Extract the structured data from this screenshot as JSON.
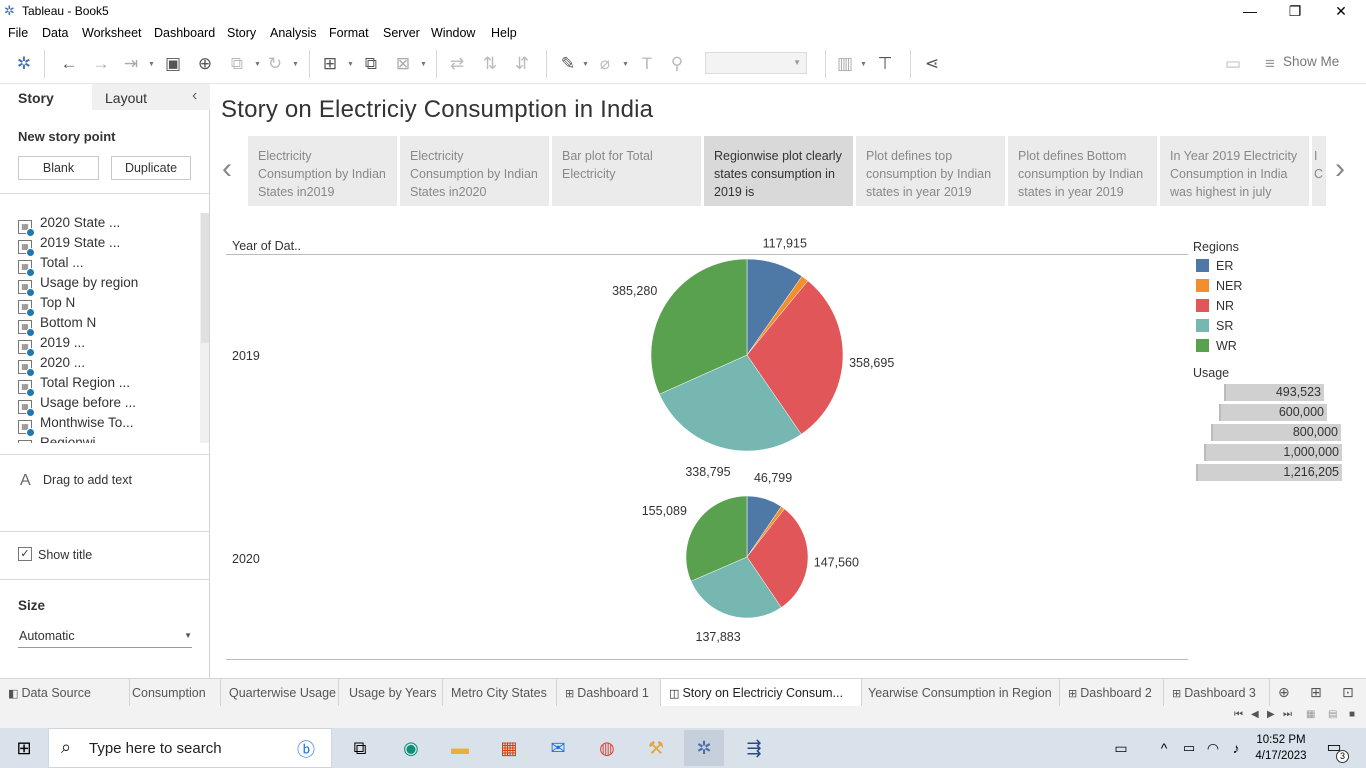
{
  "window": {
    "title": "Tableau - Book5",
    "minimize": "—",
    "maximize": "❐",
    "close": "✕"
  },
  "menu": [
    "File",
    "Data",
    "Worksheet",
    "Dashboard",
    "Story",
    "Analysis",
    "Format",
    "Server",
    "Window",
    "Help"
  ],
  "toolbar": {
    "show_me": "Show Me"
  },
  "left_pane": {
    "tabs": {
      "story": "Story",
      "layout": "Layout"
    },
    "new_story_point": "New story point",
    "blank_button": "Blank",
    "duplicate_button": "Duplicate",
    "sheets": [
      "2020 State ...",
      "2019 State ...",
      "Total ...",
      "Usage by region",
      "Top N",
      "Bottom N",
      "2019 ...",
      "2020 ...",
      "Total Region ...",
      "Usage before ...",
      "Monthwise To...",
      "Regionwi..."
    ],
    "drag_text": "Drag to add text",
    "show_title": "Show title",
    "size_label": "Size",
    "size_value": "Automatic"
  },
  "story": {
    "title": "Story on Electriciy Consumption in India",
    "points": [
      "Electricity Consumption by Indian States in2019",
      "Electricity Consumption by Indian States in2020",
      "Bar plot for Total Electricity",
      "Regionwise plot clearly states consumption in 2019 is",
      "Plot defines top consumption by Indian states in year  2019",
      "Plot defines Bottom consumption by Indian states in year  2019",
      "In Year 2019 Electricity Consumption in India was highest in july",
      "I C"
    ],
    "active_point": 3
  },
  "chart_data": {
    "type": "pie",
    "row_header": "Year of Dat..",
    "categories": [
      "ER",
      "NER",
      "NR",
      "SR",
      "WR"
    ],
    "colors": [
      "#4e79a7",
      "#f28e2b",
      "#e15759",
      "#76b7b2",
      "#59a14f"
    ],
    "series": [
      {
        "name": "2019",
        "values": [
          117915,
          15000,
          358695,
          338795,
          385280
        ],
        "labels": [
          "117,915",
          "",
          "358,695",
          "338,795",
          "385,280"
        ]
      },
      {
        "name": "2020",
        "values": [
          46799,
          5000,
          147560,
          137883,
          155089
        ],
        "labels": [
          "46,799",
          "",
          "147,560",
          "137,883",
          "155,089"
        ]
      }
    ],
    "size_legend": {
      "title": "Usage",
      "values": [
        "493,523",
        "600,000",
        "800,000",
        "1,000,000",
        "1,216,205"
      ]
    },
    "color_legend_title": "Regions"
  },
  "sheet_tabs": [
    "Data Source",
    "Consumption",
    "Quarterwise Usage",
    "Usage by Years",
    "Metro City States",
    "Dashboard 1",
    "Story on Electriciy Consum...",
    "Yearwise Consumption in Region",
    "Dashboard 2",
    "Dashboard 3"
  ],
  "taskbar": {
    "search_placeholder": "Type here to search",
    "time": "10:52 PM",
    "date": "4/17/2023",
    "notifications": "3"
  }
}
